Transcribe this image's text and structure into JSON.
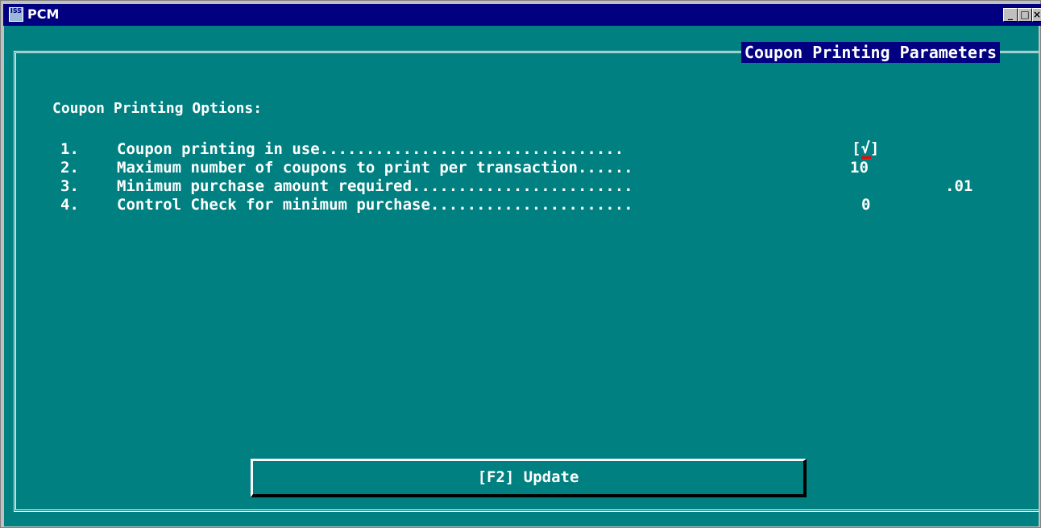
{
  "window": {
    "title": "PCM",
    "icon": "iss-app-icon",
    "controls": {
      "minimize": "_",
      "maximize": "□",
      "close": "×"
    }
  },
  "screen": {
    "title": "Coupon Printing Parameters",
    "options_heading": "Coupon Printing Options:",
    "options": [
      {
        "number": "1.",
        "label": "Coupon printing in use.................................",
        "value": "[√]"
      },
      {
        "number": "2.",
        "label": "Maximum number of coupons to print per transaction......",
        "value": "10"
      },
      {
        "number": "3.",
        "label": "Minimum purchase amount required........................",
        "value": ".01"
      },
      {
        "number": "4.",
        "label": "Control Check for minimum purchase......................",
        "value": "0"
      }
    ]
  },
  "footer": {
    "update_button": "[F2] Update"
  },
  "colors": {
    "background": "#008080",
    "titlebar": "#000080",
    "text": "#ffffff",
    "cursor": "#ff0000"
  }
}
